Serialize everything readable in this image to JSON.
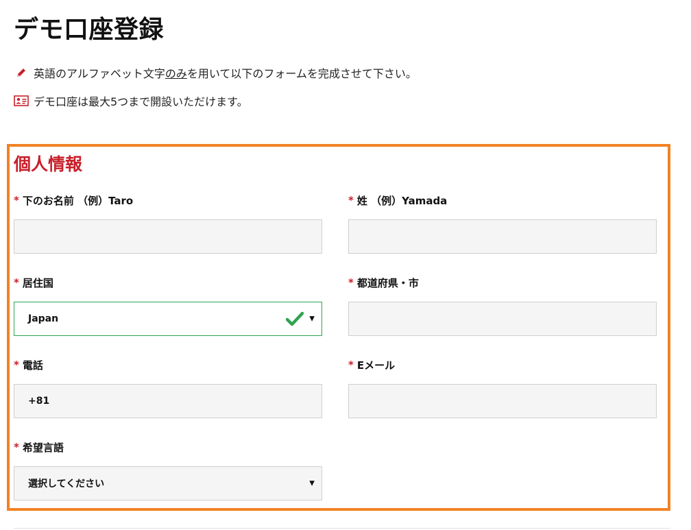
{
  "page": {
    "title": "デモ口座登録"
  },
  "notes": [
    {
      "icon": "pencil-icon",
      "text_before": "英語のアルファベット文字",
      "text_underlined": "のみ",
      "text_after": "を用いて以下のフォームを完成させて下さい。"
    },
    {
      "icon": "id-card-icon",
      "text": "デモ口座は最大5つまで開設いただけます。"
    }
  ],
  "section": {
    "title": "個人情報",
    "border_color": "#f28224",
    "title_color": "#c8202a"
  },
  "required_mark": "*",
  "fields": {
    "first_name": {
      "label": "下のお名前 （例）Taro",
      "value": ""
    },
    "last_name": {
      "label": "姓 （例）Yamada",
      "value": ""
    },
    "country": {
      "label": "居住国",
      "value": "Japan",
      "valid": true
    },
    "city": {
      "label": "都道府県・市",
      "value": ""
    },
    "phone": {
      "label": "電話",
      "value": "+81"
    },
    "email": {
      "label": "Eメール",
      "value": ""
    },
    "language": {
      "label": "希望言語",
      "value": "選択してください"
    }
  }
}
